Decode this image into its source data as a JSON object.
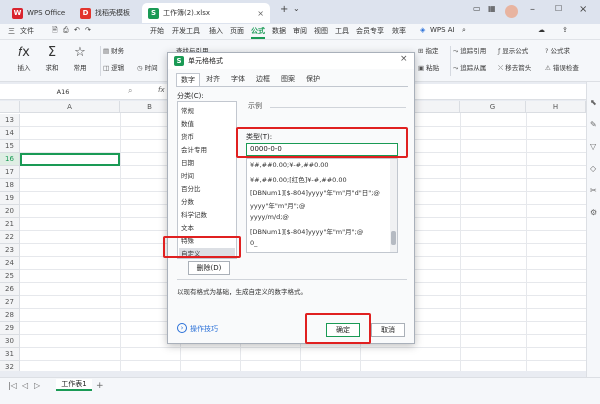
{
  "tabs": {
    "wps": "WPS Office",
    "template": "找稻壳模板",
    "workbook": "工作簿(2).xlsx"
  },
  "menu": {
    "items": [
      "三",
      "文件",
      "开始",
      "开发工具",
      "插入",
      "页面",
      "公式",
      "数据",
      "审阅",
      "视图",
      "工具",
      "会员专享",
      "效率"
    ],
    "wpsai": "WPS AI"
  },
  "ribbon": {
    "insert_func": "插入",
    "sum": "求和",
    "common": "常用",
    "finance": "财务",
    "logic": "逻辑",
    "time": "时间",
    "lookup": "查找与引用",
    "name_mgr": "指定",
    "paste": "粘贴",
    "trace_ref": "追踪引用",
    "trace_dep": "追踪从属",
    "show_formula": "显示公式",
    "remove_arrow": "移去箭头",
    "formula_check": "公式求",
    "error_check": "错误检查"
  },
  "formula_bar": {
    "name_box": "A16",
    "fx": "fx"
  },
  "sheet": {
    "columns": [
      "A",
      "B",
      "C",
      "D",
      "E",
      "F",
      "G",
      "H"
    ],
    "rows": [
      "13",
      "14",
      "15",
      "16",
      "17",
      "18",
      "19",
      "20",
      "21",
      "22",
      "23",
      "24",
      "25",
      "26",
      "27",
      "28",
      "29",
      "30",
      "31",
      "32"
    ],
    "selected_row": "16",
    "tab_name": "工作表1"
  },
  "dialog": {
    "title": "单元格格式",
    "close": "×",
    "tabs": [
      "数字",
      "对齐",
      "字体",
      "边框",
      "图案",
      "保护"
    ],
    "category_label": "分类(C):",
    "categories": [
      "常规",
      "数值",
      "货币",
      "会计专用",
      "日期",
      "时间",
      "百分比",
      "分数",
      "科学记数",
      "文本",
      "特殊",
      "自定义"
    ],
    "example_label": "示例",
    "type_label": "类型(T):",
    "type_value": "0000-0-0",
    "formats": [
      "¥#,##0.00;¥-#,##0.00",
      "¥#,##0.00;[红色]¥-#,##0.00",
      "[DBNum1][$-804]yyyy\"年\"m\"月\"d\"日\";@",
      "yyyy\"年\"m\"月\";@",
      "yyyy/m/d;@",
      "[DBNum1][$-804]yyyy\"年\"m\"月\";@",
      "0_"
    ],
    "delete_btn": "删除(D)",
    "description": "以现有格式为基础，生成自定义的数字格式。",
    "tips": "操作技巧",
    "ok": "确定",
    "cancel": "取消"
  },
  "colors": {
    "accent": "#1a9a55",
    "highlight": "#e02020"
  }
}
